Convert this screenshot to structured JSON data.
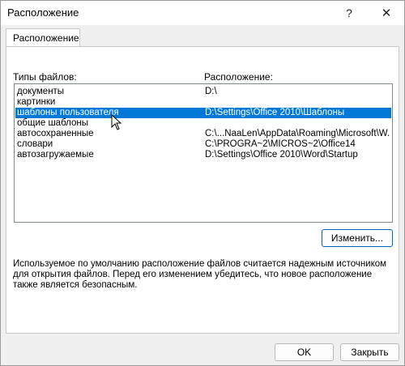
{
  "window": {
    "title": "Расположение",
    "help_glyph": "?",
    "close_glyph": "✕"
  },
  "tabs": [
    {
      "label": "Расположение"
    }
  ],
  "list": {
    "header_type": "Типы файлов:",
    "header_location": "Расположение:",
    "rows": [
      {
        "type": "документы",
        "location": "D:\\"
      },
      {
        "type": "картинки",
        "location": ""
      },
      {
        "type": "шаблоны пользователя",
        "location": "D:\\Settings\\Office 2010\\Шаблоны",
        "selected": true
      },
      {
        "type": "общие шаблоны",
        "location": ""
      },
      {
        "type": "автосохраненные",
        "location": "C:\\...NaaLen\\AppData\\Roaming\\Microsoft\\W..."
      },
      {
        "type": "словари",
        "location": "C:\\PROGRA~2\\MICROS~2\\Office14"
      },
      {
        "type": "автозагружаемые",
        "location": "D:\\Settings\\Office 2010\\Word\\Startup"
      }
    ]
  },
  "buttons": {
    "modify": "Изменить...",
    "ok": "OK",
    "close": "Закрыть"
  },
  "note": "Используемое по умолчанию расположение файлов считается надежным источником для открытия файлов. Перед его изменением убедитесь, что новое расположение также является безопасным.",
  "colors": {
    "selection": "#0078d7",
    "dialog_bg": "#f0f0f0"
  }
}
